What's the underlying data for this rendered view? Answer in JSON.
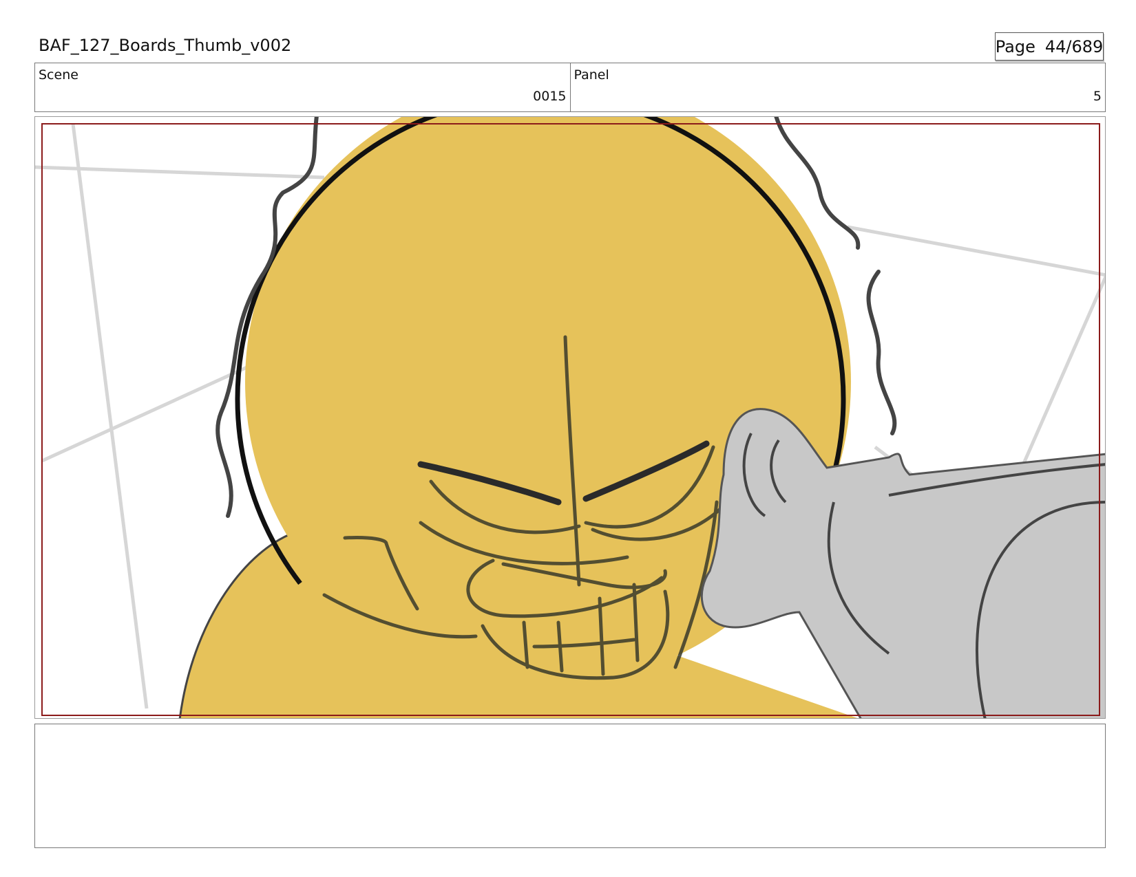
{
  "header": {
    "title": "BAF_127_Boards_Thumb_v002",
    "page_label": "Page",
    "page_value": "44/689"
  },
  "info": {
    "scene_label": "Scene",
    "scene_value": "0015",
    "panel_label": "Panel",
    "panel_value": "5"
  },
  "colors": {
    "skin": "#e6c25a",
    "safe_frame": "#8b1a1a",
    "hand": "#c8c8c8",
    "ink": "#111111"
  },
  "notes": {
    "text": ""
  }
}
